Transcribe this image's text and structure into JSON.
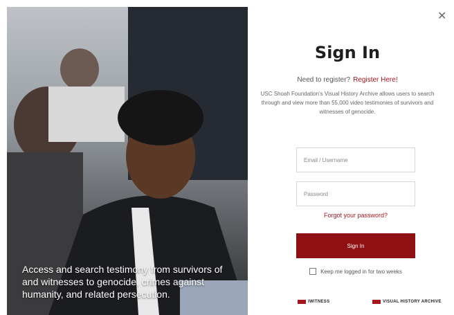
{
  "photo": {
    "caption": "Access and search testimony from survivors of and witnesses to genocide, crimes against humanity, and related persecution."
  },
  "close": {
    "label": "✕"
  },
  "signin": {
    "title": "Sign In",
    "register_prompt": "Need to register?",
    "register_link": "Register Here!",
    "description": "USC Shoah Foundation's Visual History Archive allows users to search through and view more than 55,000 video testimonies of survivors and witnesses of genocide.",
    "email_placeholder": "Email / Username",
    "password_placeholder": "Password",
    "forgot_link": "Forgot your password?",
    "signin_button": "Sign In",
    "keep_logged_in": "Keep me logged in for two weeks"
  },
  "logos": {
    "iwitness": "IWITNESS",
    "vha": "VISUAL HISTORY ARCHIVE"
  },
  "colors": {
    "accent": "#a3171c",
    "button": "#8f1013",
    "title": "#1e1e1e"
  }
}
